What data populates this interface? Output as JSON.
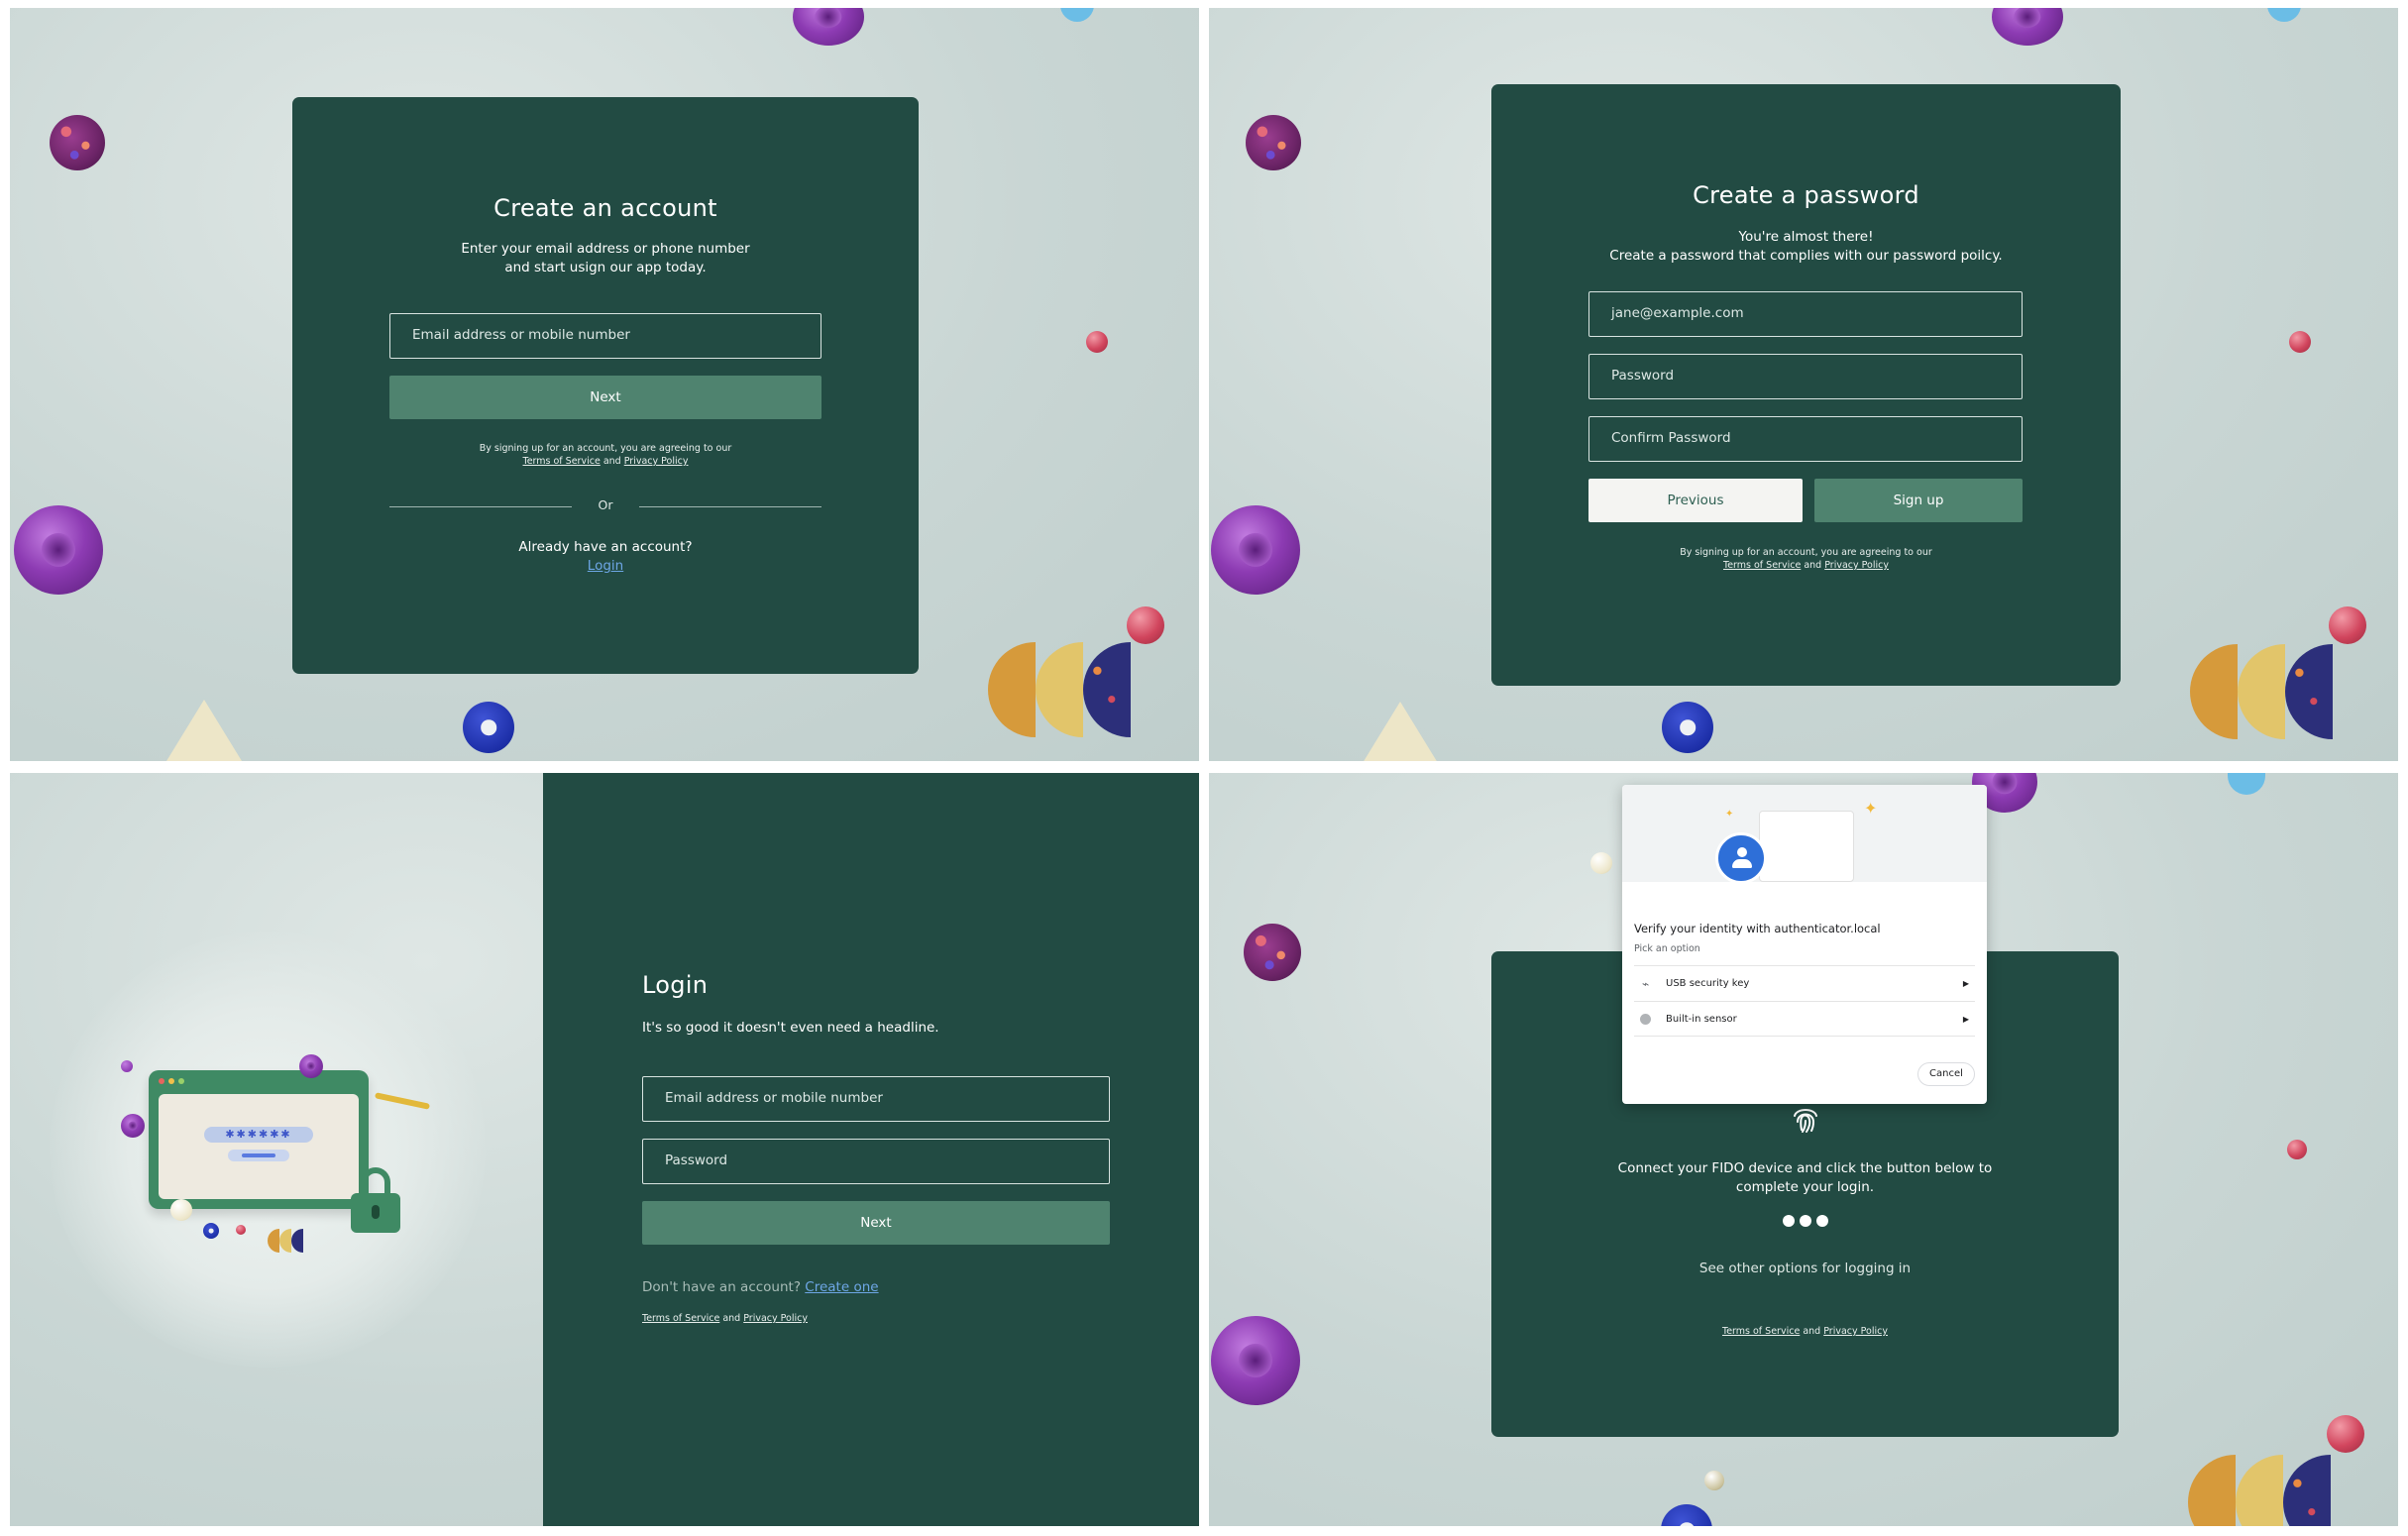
{
  "create_account": {
    "title": "Create an account",
    "subtitle_line1": "Enter your email address or phone number",
    "subtitle_line2": "and start usign our app today.",
    "email_placeholder": "Email address or mobile number",
    "next_label": "Next",
    "legal_prefix": "By signing up for an account, you are agreeing to our",
    "terms_label": "Terms of Service",
    "and_label": "and",
    "privacy_label": "Privacy Policy",
    "divider_label": "Or",
    "have_account": "Already have an account?",
    "login_link": "Login"
  },
  "create_password": {
    "title": "Create a password",
    "subtitle_line1": "You're almost there!",
    "subtitle_line2": "Create a password that complies with our password poilcy.",
    "email_value": "jane@example.com",
    "password_placeholder": "Password",
    "confirm_placeholder": "Confirm Password",
    "previous_label": "Previous",
    "signup_label": "Sign up",
    "legal_prefix": "By signing up for an account, you are agreeing to our",
    "terms_label": "Terms of Service",
    "and_label": "and",
    "privacy_label": "Privacy Policy"
  },
  "login": {
    "title": "Login",
    "subtitle": "It's so good it doesn't even need a headline.",
    "email_placeholder": "Email address or mobile number",
    "password_placeholder": "Password",
    "next_label": "Next",
    "no_account": "Don't have an account?",
    "create_link": "Create one",
    "terms_label": "Terms of Service",
    "and_label": "and",
    "privacy_label": "Privacy Policy"
  },
  "fido": {
    "dialog_title": "Verify your identity with authenticator.local",
    "pick_option": "Pick an option",
    "options": [
      "USB security key",
      "Built-in sensor"
    ],
    "cancel_label": "Cancel",
    "message_line1": "Connect your FIDO device and click the button below to",
    "message_line2": "complete your login.",
    "other_options": "See other options for logging in",
    "terms_label": "Terms of Service",
    "and_label": "and",
    "privacy_label": "Privacy Policy"
  },
  "icons": [
    "fingerprint-icon",
    "usb-icon",
    "sensor-icon",
    "chevron-right-icon",
    "user-avatar-icon",
    "lock-icon"
  ],
  "colors": {
    "card_green": "#224b43",
    "button_green": "#4f836f",
    "link_blue": "#6ea7e6",
    "background": "#c9d6d4",
    "accent_purple": "#8d3bb3"
  }
}
